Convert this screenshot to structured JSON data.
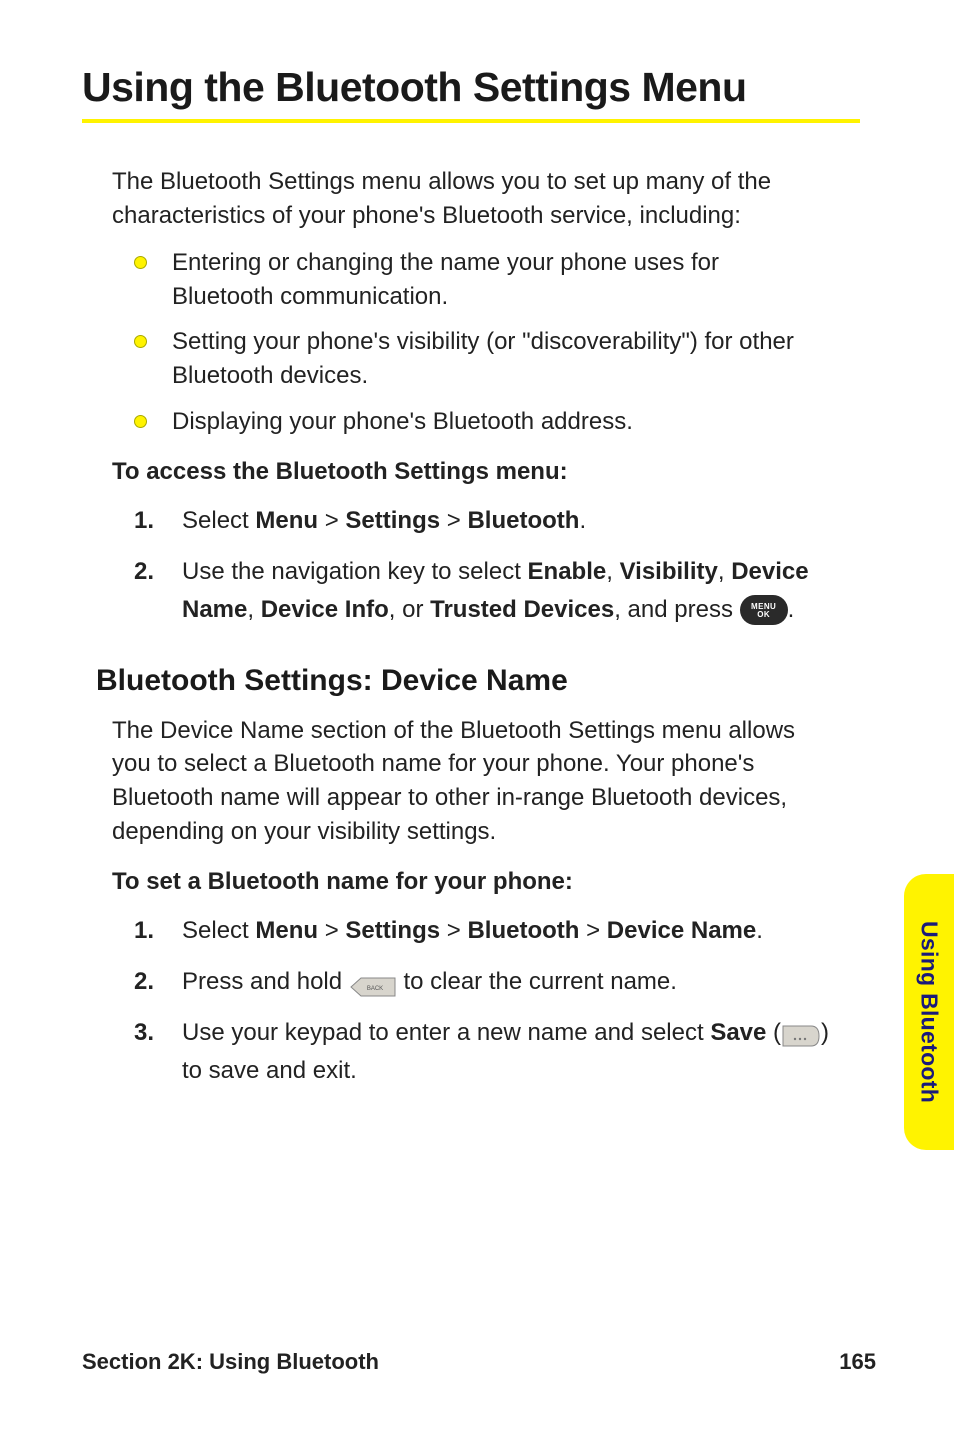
{
  "title": "Using the Bluetooth Settings Menu",
  "intro": "The Bluetooth Settings menu allows you to set up many of the characteristics of your phone's Bluetooth service, including:",
  "bullets": [
    "Entering or changing the name your phone uses for Bluetooth communication.",
    "Setting your phone's visibility (or \"discoverability\") for other Bluetooth devices.",
    "Displaying your phone's Bluetooth address."
  ],
  "access_heading": "To access the Bluetooth Settings menu:",
  "access_steps": {
    "num1": "1.",
    "num2": "2.",
    "word_select": "Select ",
    "menu": "Menu",
    "sep": " > ",
    "settings": "Settings",
    "bluetooth": "Bluetooth",
    "period": ".",
    "step2_lead": "Use the navigation key to select ",
    "enable": "Enable",
    "comma_sp": ", ",
    "visibility": "Visibility",
    "device_name": "Device Name",
    "device_info": "Device Info",
    "or_sp": ", or ",
    "trusted": "Trusted Devices",
    "and_press": ", and press ",
    "menu_ok_label": "MENU",
    "ok_label": "OK"
  },
  "section2_title": "Bluetooth Settings: Device Name",
  "section2_para": "The Device Name section of the Bluetooth Settings menu allows you to select a Bluetooth name for your phone. Your phone's Bluetooth name will appear to other in-range Bluetooth devices, depending on your visibility settings.",
  "set_name_heading": "To set a Bluetooth name for your phone:",
  "set_steps": {
    "num1": "1.",
    "num2": "2.",
    "num3": "3.",
    "word_select": "Select ",
    "menu": "Menu",
    "sep": " > ",
    "settings": "Settings",
    "bluetooth": "Bluetooth",
    "device_name_label": "Device Name",
    "period": ".",
    "press_hold": "Press and hold ",
    "clear_rest": " to clear the current name.",
    "step3_lead": "Use your keypad to enter a new name and select ",
    "save": "Save",
    "save_paren_open": " (",
    "save_paren_close": ") to save and exit."
  },
  "side_tab": "Using Bluetooth",
  "footer_left": "Section 2K: Using Bluetooth",
  "footer_right": "165"
}
